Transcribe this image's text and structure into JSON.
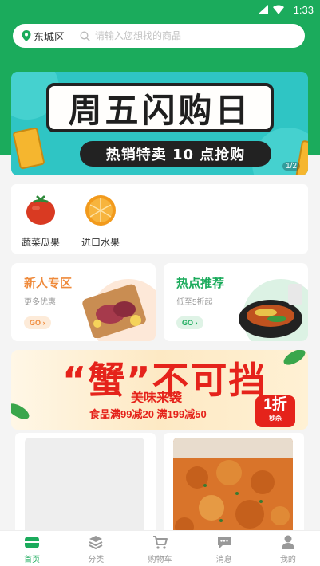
{
  "status_bar": {
    "time": "1:33"
  },
  "header": {
    "location": "东城区",
    "search_placeholder": "请输入您想找的商品"
  },
  "banner": {
    "title": "周五闪购日",
    "subtitle": "热销特卖 10 点抢购",
    "pager": "1/2"
  },
  "categories": [
    {
      "label": "蔬菜瓜果",
      "icon": "tomato-icon"
    },
    {
      "label": "进口水果",
      "icon": "orange-icon"
    }
  ],
  "promos": [
    {
      "title": "新人专区",
      "subtitle": "更多优惠",
      "go": "GO",
      "color": "#ef8a3b"
    },
    {
      "title": "热点推荐",
      "subtitle": "低至5折起",
      "go": "GO",
      "color": "#1bab5c"
    }
  ],
  "crab_banner": {
    "title": "“蟹”不可挡",
    "subtitle": "美味来袭",
    "deal": "食品满99减20 满199减50",
    "badge_top": "1折",
    "badge_bottom": "秒杀"
  },
  "tabs": [
    {
      "label": "首页",
      "icon": "home-icon",
      "active": true
    },
    {
      "label": "分类",
      "icon": "category-icon",
      "active": false
    },
    {
      "label": "购物车",
      "icon": "cart-icon",
      "active": false
    },
    {
      "label": "消息",
      "icon": "message-icon",
      "active": false
    },
    {
      "label": "我的",
      "icon": "profile-icon",
      "active": false
    }
  ],
  "colors": {
    "brand": "#1bab5c",
    "orange": "#ef8a3b",
    "red": "#e5231b"
  }
}
